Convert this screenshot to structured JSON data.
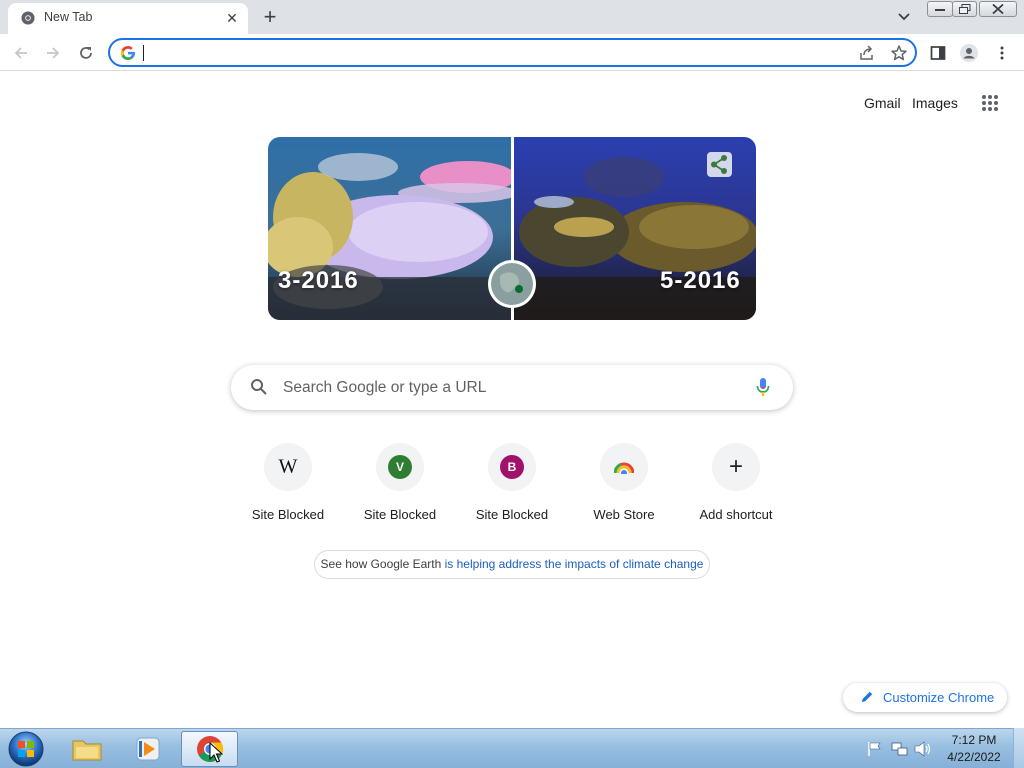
{
  "tab": {
    "title": "New Tab",
    "close_glyph": "✕",
    "new_tab_glyph": "+"
  },
  "toolbar": {
    "omnibox_value": ""
  },
  "header": {
    "gmail": "Gmail",
    "images": "Images"
  },
  "doodle": {
    "left_label": "3-2016",
    "right_label": "5-2016"
  },
  "search": {
    "placeholder": "Search Google or type a URL"
  },
  "shortcuts": [
    {
      "label": "Site Blocked",
      "icon_letter": "W",
      "icon": "wikipedia-icon"
    },
    {
      "label": "Site Blocked",
      "icon_letter": "V",
      "icon": "letter-v-icon",
      "color": "#2e7d32"
    },
    {
      "label": "Site Blocked",
      "icon_letter": "B",
      "icon": "letter-b-icon",
      "color": "#a0126b"
    },
    {
      "label": "Web Store",
      "icon": "web-store-icon"
    },
    {
      "label": "Add shortcut",
      "icon": "plus-icon",
      "icon_letter": "+"
    }
  ],
  "promo": {
    "text_plain": "See how Google Earth ",
    "text_link": "is helping address the impacts of climate change"
  },
  "customize": {
    "label": "Customize Chrome"
  },
  "taskbar": {
    "time": "7:12 PM",
    "date": "4/22/2022"
  },
  "colors": {
    "accent": "#1a73e8",
    "tabstrip": "#dee1e6",
    "taskbar": "#98bfe0"
  }
}
